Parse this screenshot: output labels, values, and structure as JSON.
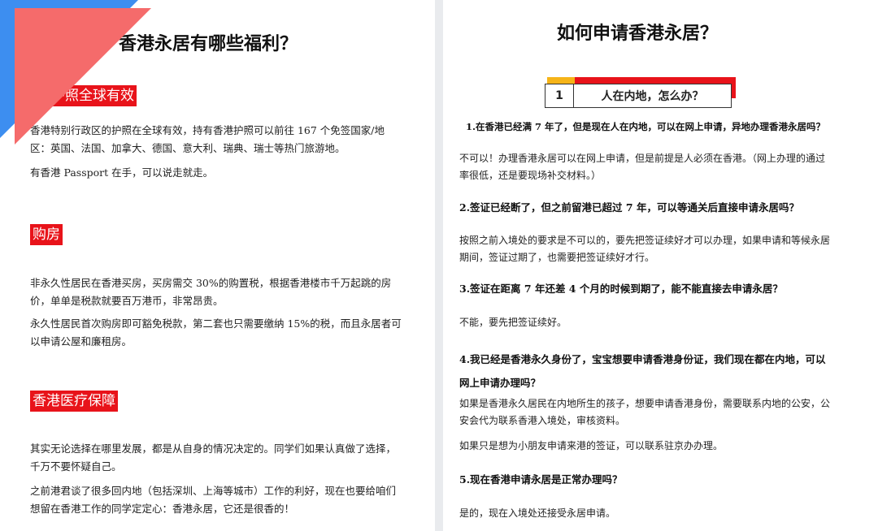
{
  "left": {
    "title": "香港永居有哪些福利？",
    "sections": [
      {
        "tag": "护照全球有效",
        "paragraphs": [
          "香港特别行政区的护照在全球有效，持有香港护照可以前往 167 个免签国家/地区：英国、法国、加拿大、德国、意大利、瑞典、瑞士等热门旅游地。",
          "有香港 Passport 在手，可以说走就走。"
        ]
      },
      {
        "tag": "购房",
        "paragraphs": [
          "非永久性居民在香港买房，买房需交 30%的购置税，根据香港楼市千万起跳的房价，单单是税款就要百万港币，非常昂贵。",
          "永久性居民首次购房即可豁免税款，第二套也只需要缴纳 15%的税，而且永居者可以申请公屋和廉租房。"
        ]
      },
      {
        "tag": "香港医疗保障",
        "paragraphs": [
          "其实无论选择在哪里发展，都是从自身的情况决定的。同学们如果认真做了选择，千万不要怀疑自己。",
          "之前港君谈了很多回内地（包括深圳、上海等城市）工作的利好，现在也要给咱们想留在香港工作的同学定定心：香港永居，它还是很香的！"
        ]
      }
    ]
  },
  "right": {
    "title": "如何申请香港永居？",
    "header": {
      "number": "1",
      "label": "人在内地，怎么办？"
    },
    "items": [
      {
        "q": "1.在香港已经满 7 年了，但是现在人在内地，可以在网上申请，异地办理香港永居吗？",
        "a": [
          "不可以！办理香港永居可以在网上申请，但是前提是人必须在香港。（网上办理的通过率很低，还是要现场补交材料。）"
        ]
      },
      {
        "q": "2.签证已经断了，但之前留港已超过 7 年，可以等通关后直接申请永居吗？",
        "a": [
          "按照之前入境处的要求是不可以的，要先把签证续好才可以办理，如果申请和等候永居期间，签证过期了，也需要把签证续好才行。"
        ]
      },
      {
        "q": "3.签证在距离 7 年还差 4 个月的时候到期了，能不能直接去申请永居？",
        "a": [
          "不能，要先把签证续好。"
        ]
      },
      {
        "q": "4.我已经是香港永久身份了，宝宝想要申请香港身份证，我们现在都在内地，可以网上申请办理吗？",
        "a": [
          "如果是香港永久居民在内地所生的孩子，想要申请香港身份，需要联系内地的公安，公安会代为联系香港入境处，审核资料。",
          "如果只是想为小朋友申请来港的签证，可以联系驻京办办理。"
        ]
      },
      {
        "q": "5.现在香港申请永居是正常办理吗？",
        "a": [
          "是的，现在入境处还接受永居申请。"
        ]
      }
    ]
  },
  "colors": {
    "accent_red": "#e8131a",
    "accent_yellow": "#f6b418",
    "corner_blue": "#3d8ef0",
    "corner_red": "#f56b6b"
  }
}
